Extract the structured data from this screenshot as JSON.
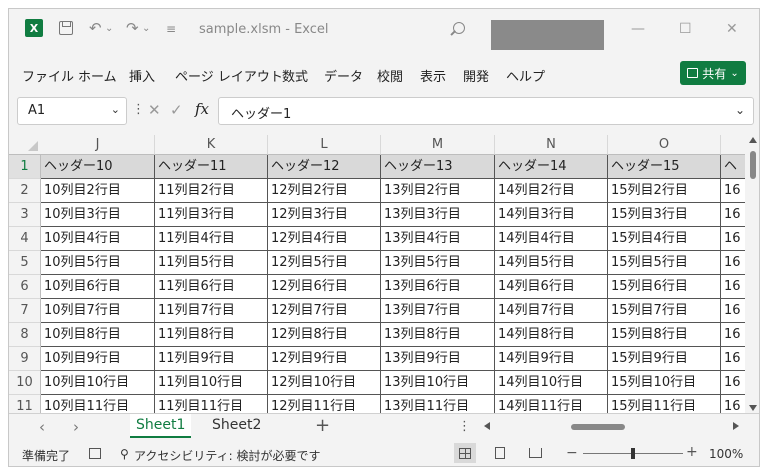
{
  "titlebar": {
    "title": "sample.xlsm  -  Excel",
    "app_icon": "excel-logo",
    "undo_icon": "undo-icon",
    "redo_icon": "redo-icon",
    "window_controls": [
      "minimize-icon",
      "maximize-icon",
      "close-icon"
    ]
  },
  "menu": {
    "items": [
      "ファイル",
      "ホーム",
      "挿入",
      "ページ レイアウト",
      "数式",
      "データ",
      "校閲",
      "表示",
      "開発",
      "ヘルプ"
    ],
    "share_label": "共有"
  },
  "formula_bar": {
    "name_box": "A1",
    "fx": "fx",
    "content": "ヘッダー1"
  },
  "grid": {
    "columns": [
      "J",
      "K",
      "L",
      "M",
      "N",
      "O"
    ],
    "rows": [
      [
        "1",
        [
          "ヘッダー10",
          "ヘッダー11",
          "ヘッダー12",
          "ヘッダー13",
          "ヘッダー14",
          "ヘッダー15",
          "ヘ"
        ]
      ],
      [
        "2",
        [
          "10列目2行目",
          "11列目2行目",
          "12列目2行目",
          "13列目2行目",
          "14列目2行目",
          "15列目2行目",
          "16"
        ]
      ],
      [
        "3",
        [
          "10列目3行目",
          "11列目3行目",
          "12列目3行目",
          "13列目3行目",
          "14列目3行目",
          "15列目3行目",
          "16"
        ]
      ],
      [
        "4",
        [
          "10列目4行目",
          "11列目4行目",
          "12列目4行目",
          "13列目4行目",
          "14列目4行目",
          "15列目4行目",
          "16"
        ]
      ],
      [
        "5",
        [
          "10列目5行目",
          "11列目5行目",
          "12列目5行目",
          "13列目5行目",
          "14列目5行目",
          "15列目5行目",
          "16"
        ]
      ],
      [
        "6",
        [
          "10列目6行目",
          "11列目6行目",
          "12列目6行目",
          "13列目6行目",
          "14列目6行目",
          "15列目6行目",
          "16"
        ]
      ],
      [
        "7",
        [
          "10列目7行目",
          "11列目7行目",
          "12列目7行目",
          "13列目7行目",
          "14列目7行目",
          "15列目7行目",
          "16"
        ]
      ],
      [
        "8",
        [
          "10列目8行目",
          "11列目8行目",
          "12列目8行目",
          "13列目8行目",
          "14列目8行目",
          "15列目8行目",
          "16"
        ]
      ],
      [
        "9",
        [
          "10列目9行目",
          "11列目9行目",
          "12列目9行目",
          "13列目9行目",
          "14列目9行目",
          "15列目9行目",
          "16"
        ]
      ],
      [
        "10",
        [
          "10列目10行目",
          "11列目10行目",
          "12列目10行目",
          "13列目10行目",
          "14列目10行目",
          "15列目10行目",
          "16"
        ]
      ],
      [
        "11",
        [
          "10列目11行目",
          "11列目11行目",
          "12列目11行目",
          "13列目11行目",
          "14列目11行目",
          "15列目11行目",
          "16"
        ]
      ]
    ]
  },
  "sheets": {
    "tabs": [
      "Sheet1",
      "Sheet2"
    ],
    "active": "Sheet1",
    "add_label": "+"
  },
  "status": {
    "ready": "準備完了",
    "accessibility": "アクセシビリティ: 検討が必要です",
    "zoom_level": "100%",
    "zoom_minus": "−",
    "zoom_plus": "+"
  },
  "colors": {
    "accent": "#107c41",
    "header_fill": "#d9d9d9"
  }
}
